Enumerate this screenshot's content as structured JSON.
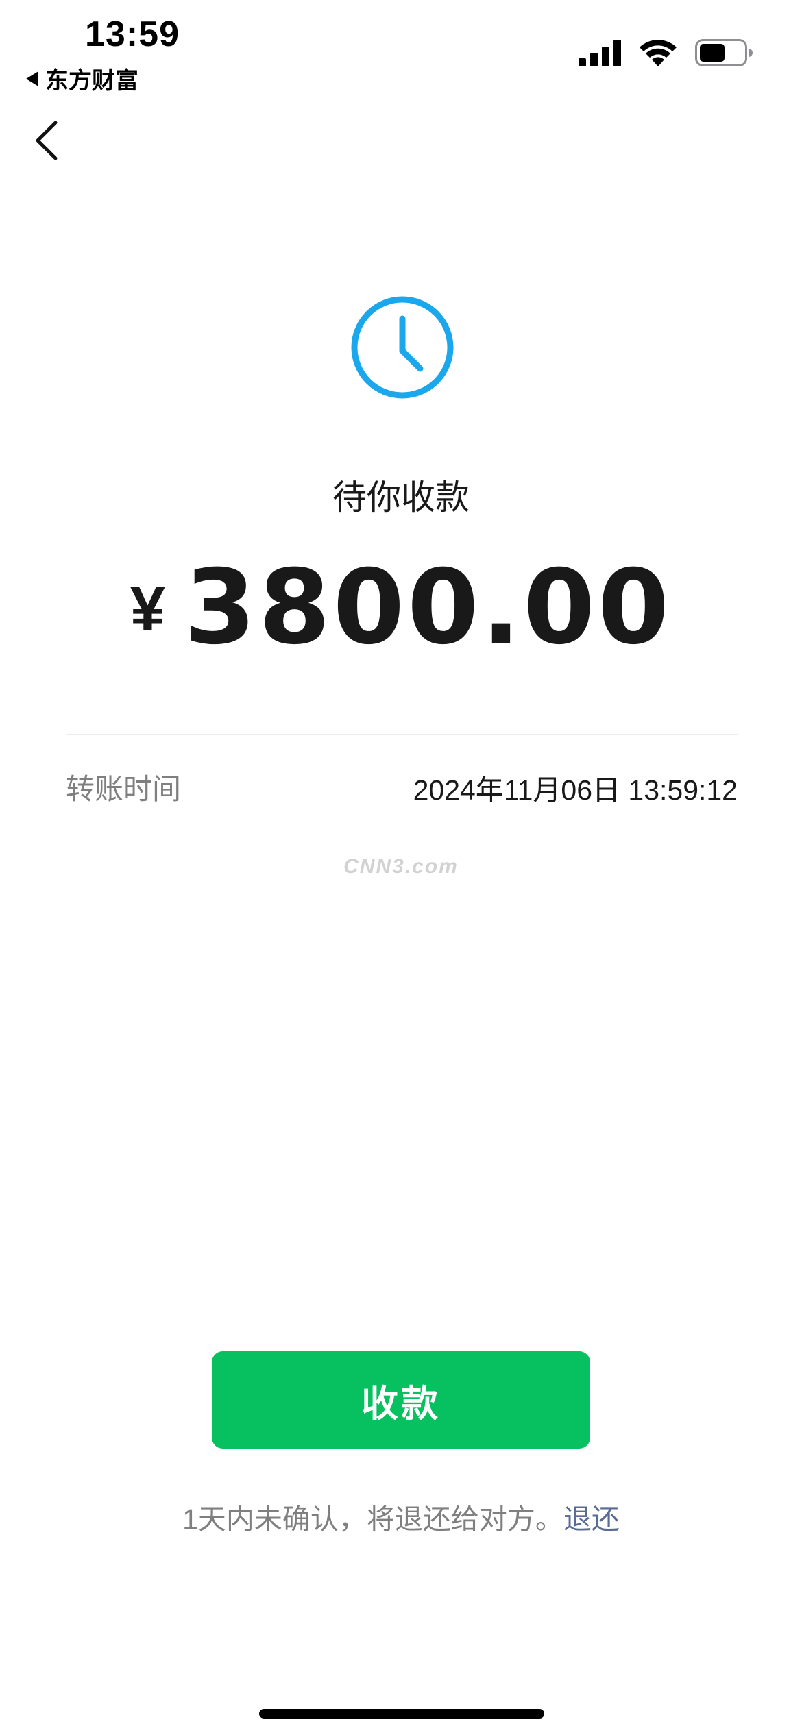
{
  "status_bar": {
    "time": "13:59",
    "back_app_label": "东方财富",
    "icons": [
      "cellular-signal-icon",
      "wifi-icon",
      "battery-icon"
    ]
  },
  "nav": {
    "back_icon": "chevron-left-icon"
  },
  "transfer": {
    "status_icon": "clock-icon",
    "status_title": "待你收款",
    "currency_symbol": "¥",
    "amount": "3800.00",
    "time_label": "转账时间",
    "time_value": "2024年11月06日 13:59:12"
  },
  "watermark": "CNN3.com",
  "actions": {
    "receive_label": "收款",
    "notice_text": "1天内未确认，将退还给对方。",
    "return_link": "退还"
  },
  "colors": {
    "accent_green": "#07c160",
    "clock_blue": "#1aa7ec",
    "link_blue": "#576b95",
    "secondary_text": "#7f7f7f"
  }
}
